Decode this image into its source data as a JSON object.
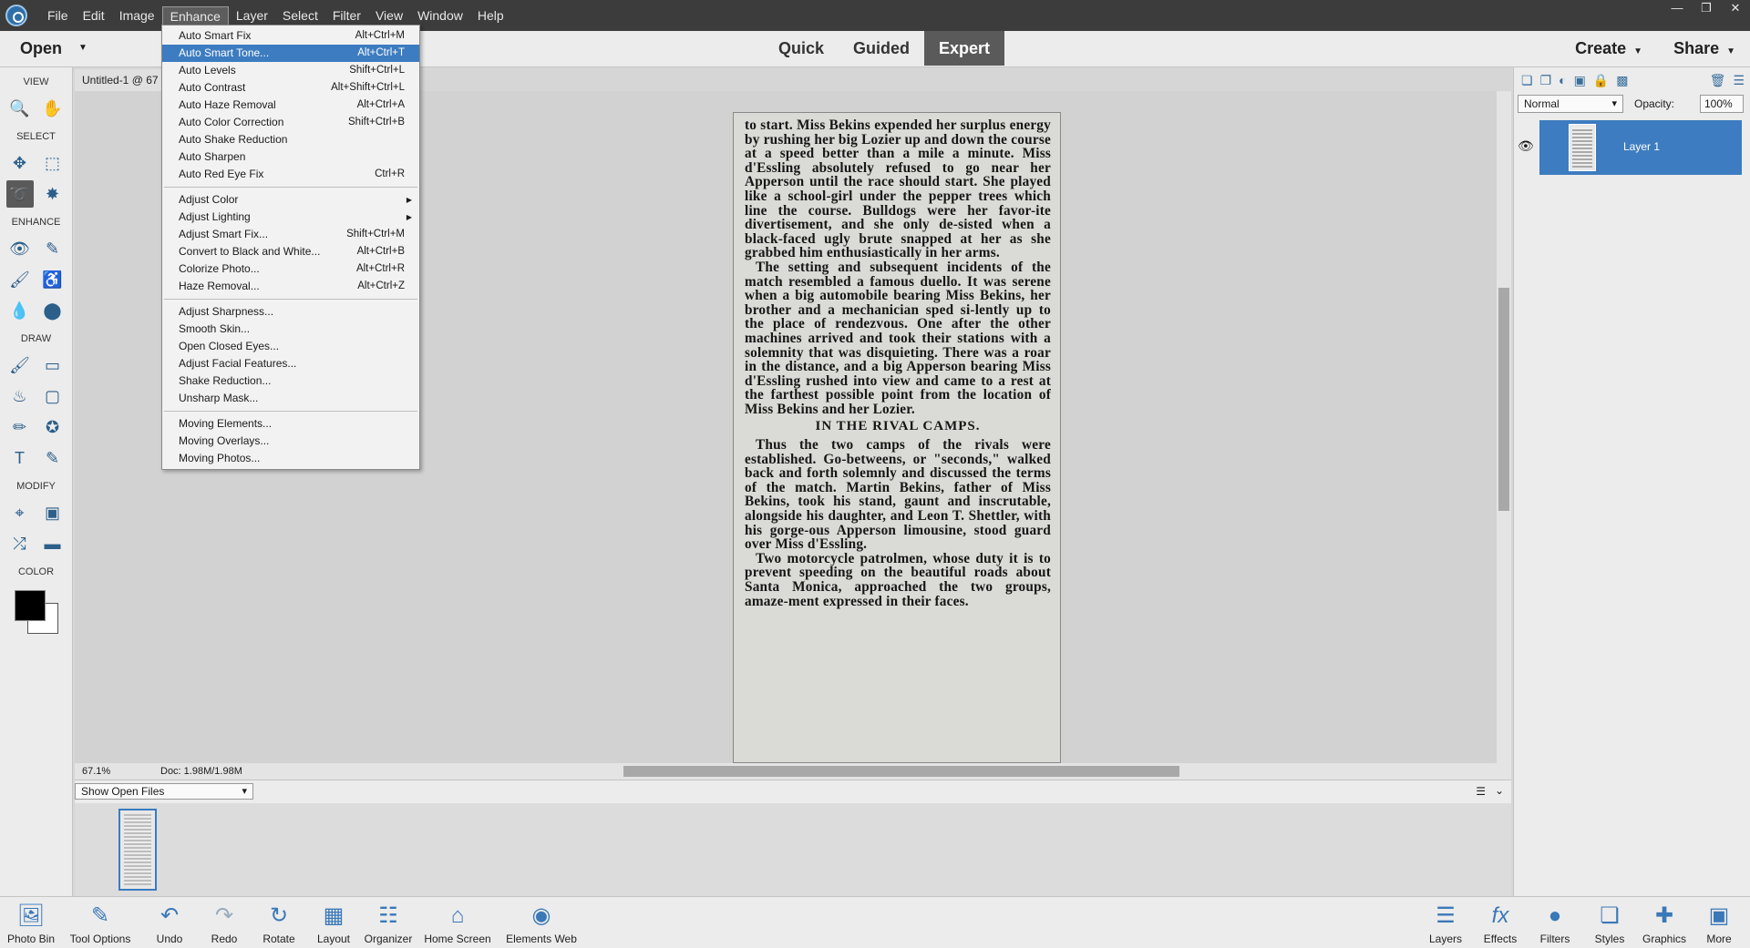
{
  "menubar": {
    "items": [
      "File",
      "Edit",
      "Image",
      "Enhance",
      "Layer",
      "Select",
      "Filter",
      "View",
      "Window",
      "Help"
    ],
    "active": "Enhance"
  },
  "modebar": {
    "open_label": "Open",
    "modes": [
      "Quick",
      "Guided",
      "Expert"
    ],
    "active_mode": "Expert",
    "create_label": "Create",
    "share_label": "Share"
  },
  "toolbox": {
    "sections": {
      "view": "VIEW",
      "select": "SELECT",
      "enhance": "ENHANCE",
      "draw": "DRAW",
      "modify": "MODIFY",
      "color": "COLOR"
    },
    "foreground_color": "#000000",
    "background_color": "#ffffff"
  },
  "document": {
    "tab_title": "Untitled-1 @ 67",
    "zoom": "67.1%",
    "doc_size": "Doc: 1.98M/1.98M",
    "paragraph1": "to start. Miss Bekins expended her surplus energy by rushing her big Lozier up and down the course at a speed better than a mile a minute. Miss d'Essling absolutely refused to go near her Apperson until the race should start. She played like a school-girl under the pepper trees which line the course. Bulldogs were her favor-ite divertisement, and she only de-sisted when a black-faced ugly brute snapped at her as she grabbed him enthusiastically in her arms.",
    "paragraph2": "The setting and subsequent incidents of the match resembled a famous duello. It was serene when a big automobile bearing Miss Bekins, her brother and a mechanician sped si-lently up to the place of rendezvous. One after the other machines arrived and took their stations with a solemnity that was disquieting. There was a roar in the distance, and a big Apperson bearing Miss d'Essling rushed into view and came to a rest at the farthest possible point from the location of Miss Bekins and her Lozier.",
    "heading": "IN THE RIVAL CAMPS.",
    "paragraph3": "Thus the two camps of the rivals were established. Go-betweens, or \"seconds,\" walked back and forth solemnly and discussed the terms of the match. Martin Bekins, father of Miss Bekins, took his stand, gaunt and inscrutable, alongside his daughter, and Leon T. Shettler, with his gorge-ous Apperson limousine, stood guard over Miss d'Essling.",
    "paragraph4": "Two motorcycle patrolmen, whose duty it is to prevent speeding on the beautiful roads about Santa Monica, approached the two groups, amaze-ment expressed in their faces."
  },
  "photo_bin": {
    "select_value": "Show Open Files"
  },
  "layers_panel": {
    "blend_mode": "Normal",
    "opacity_label": "Opacity:",
    "opacity_value": "100%",
    "layer_name": "Layer 1"
  },
  "taskbar": {
    "left": [
      "Photo Bin",
      "Tool Options",
      "Undo",
      "Redo",
      "Rotate",
      "Layout",
      "Organizer",
      "Home Screen",
      "Elements Web"
    ],
    "right": [
      "Layers",
      "Effects",
      "Filters",
      "Styles",
      "Graphics",
      "More"
    ]
  },
  "enhance_menu": {
    "group1": [
      {
        "label": "Auto Smart Fix",
        "shortcut": "Alt+Ctrl+M"
      },
      {
        "label": "Auto Smart Tone...",
        "shortcut": "Alt+Ctrl+T"
      },
      {
        "label": "Auto Levels",
        "shortcut": "Shift+Ctrl+L"
      },
      {
        "label": "Auto Contrast",
        "shortcut": "Alt+Shift+Ctrl+L"
      },
      {
        "label": "Auto Haze Removal",
        "shortcut": "Alt+Ctrl+A"
      },
      {
        "label": "Auto Color Correction",
        "shortcut": "Shift+Ctrl+B"
      },
      {
        "label": "Auto Shake Reduction",
        "shortcut": ""
      },
      {
        "label": "Auto Sharpen",
        "shortcut": ""
      },
      {
        "label": "Auto Red Eye Fix",
        "shortcut": "Ctrl+R"
      }
    ],
    "group2": [
      {
        "label": "Adjust Color",
        "shortcut": ""
      },
      {
        "label": "Adjust Lighting",
        "shortcut": ""
      },
      {
        "label": "Adjust Smart Fix...",
        "shortcut": "Shift+Ctrl+M"
      },
      {
        "label": "Convert to Black and White...",
        "shortcut": "Alt+Ctrl+B"
      },
      {
        "label": "Colorize Photo...",
        "shortcut": "Alt+Ctrl+R"
      },
      {
        "label": "Haze Removal...",
        "shortcut": "Alt+Ctrl+Z"
      }
    ],
    "group3": [
      {
        "label": "Adjust Sharpness..."
      },
      {
        "label": "Smooth Skin..."
      },
      {
        "label": "Open Closed Eyes..."
      },
      {
        "label": "Adjust Facial Features..."
      },
      {
        "label": "Shake Reduction..."
      },
      {
        "label": "Unsharp Mask..."
      }
    ],
    "group4": [
      {
        "label": "Moving Elements..."
      },
      {
        "label": "Moving Overlays..."
      },
      {
        "label": "Moving Photos..."
      }
    ],
    "highlighted": "Auto Smart Tone..."
  }
}
